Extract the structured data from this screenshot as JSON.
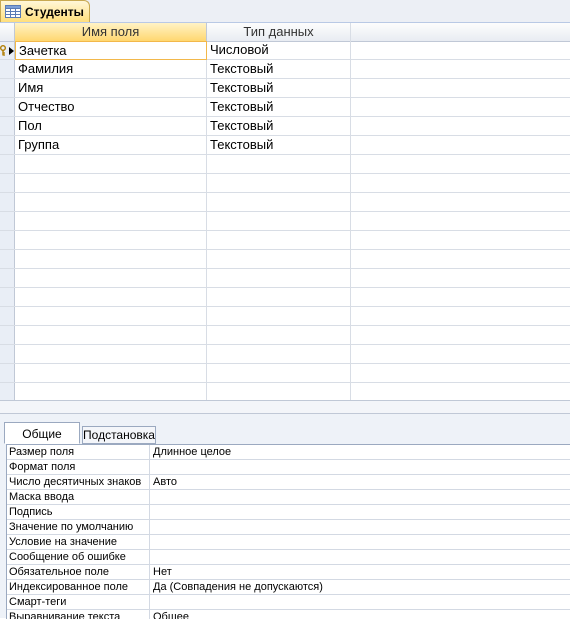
{
  "document_tab": {
    "label": "Студенты"
  },
  "grid": {
    "headers": {
      "field_name": "Имя поля",
      "data_type": "Тип данных"
    },
    "rows": [
      {
        "name": "Зачетка",
        "type": "Числовой"
      },
      {
        "name": "Фамилия",
        "type": "Текстовый"
      },
      {
        "name": "Имя",
        "type": "Текстовый"
      },
      {
        "name": "Отчество",
        "type": "Текстовый"
      },
      {
        "name": "Пол",
        "type": "Текстовый"
      },
      {
        "name": "Группа",
        "type": "Текстовый"
      }
    ]
  },
  "properties": {
    "tabs": {
      "general": "Общие",
      "lookup": "Подстановка"
    },
    "rows": [
      {
        "label": "Размер поля",
        "value": "Длинное целое"
      },
      {
        "label": "Формат поля",
        "value": ""
      },
      {
        "label": "Число десятичных знаков",
        "value": "Авто"
      },
      {
        "label": "Маска ввода",
        "value": ""
      },
      {
        "label": "Подпись",
        "value": ""
      },
      {
        "label": "Значение по умолчанию",
        "value": ""
      },
      {
        "label": "Условие на значение",
        "value": ""
      },
      {
        "label": "Сообщение об ошибке",
        "value": ""
      },
      {
        "label": "Обязательное поле",
        "value": "Нет"
      },
      {
        "label": "Индексированное поле",
        "value": "Да (Совпадения не допускаются)"
      },
      {
        "label": "Смарт-теги",
        "value": ""
      },
      {
        "label": "Выравнивание текста",
        "value": "Общее"
      }
    ]
  },
  "colors": {
    "accent": "#ffd770",
    "grid_line": "#d8dde5",
    "pane_bg": "#eef2f8"
  },
  "icons": {
    "tab": "table-icon",
    "primary_key": "primary-key-icon",
    "row_pointer": "current-row-arrow-icon"
  }
}
